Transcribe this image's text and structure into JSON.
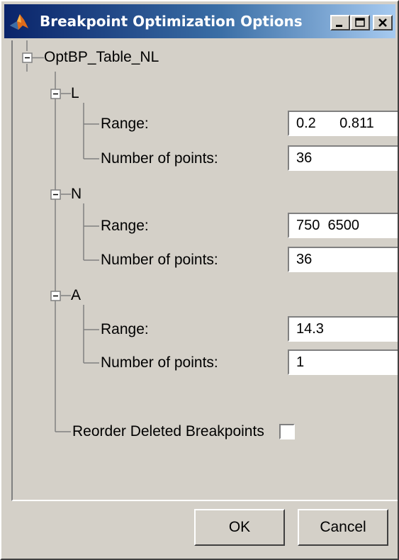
{
  "window": {
    "title": "Breakpoint Optimization Options",
    "app_icon": "matlab-logo-icon",
    "controls": [
      "minimize-icon",
      "maximize-icon",
      "close-icon"
    ]
  },
  "tree": {
    "root_label": "OptBP_Table_NL",
    "nodes": [
      {
        "label": "L",
        "range_label": "Range:",
        "range_value": "0.2      0.811",
        "points_label": "Number of points:",
        "points_value": "36"
      },
      {
        "label": "N",
        "range_label": "Range:",
        "range_value": "750  6500",
        "points_label": "Number of points:",
        "points_value": "36"
      },
      {
        "label": "A",
        "range_label": "Range:",
        "range_value": "14.3",
        "points_label": "Number of points:",
        "points_value": "1"
      }
    ],
    "reorder_label": "Reorder Deleted Breakpoints",
    "reorder_checked": false
  },
  "buttons": {
    "ok_label": "OK",
    "cancel_label": "Cancel"
  }
}
